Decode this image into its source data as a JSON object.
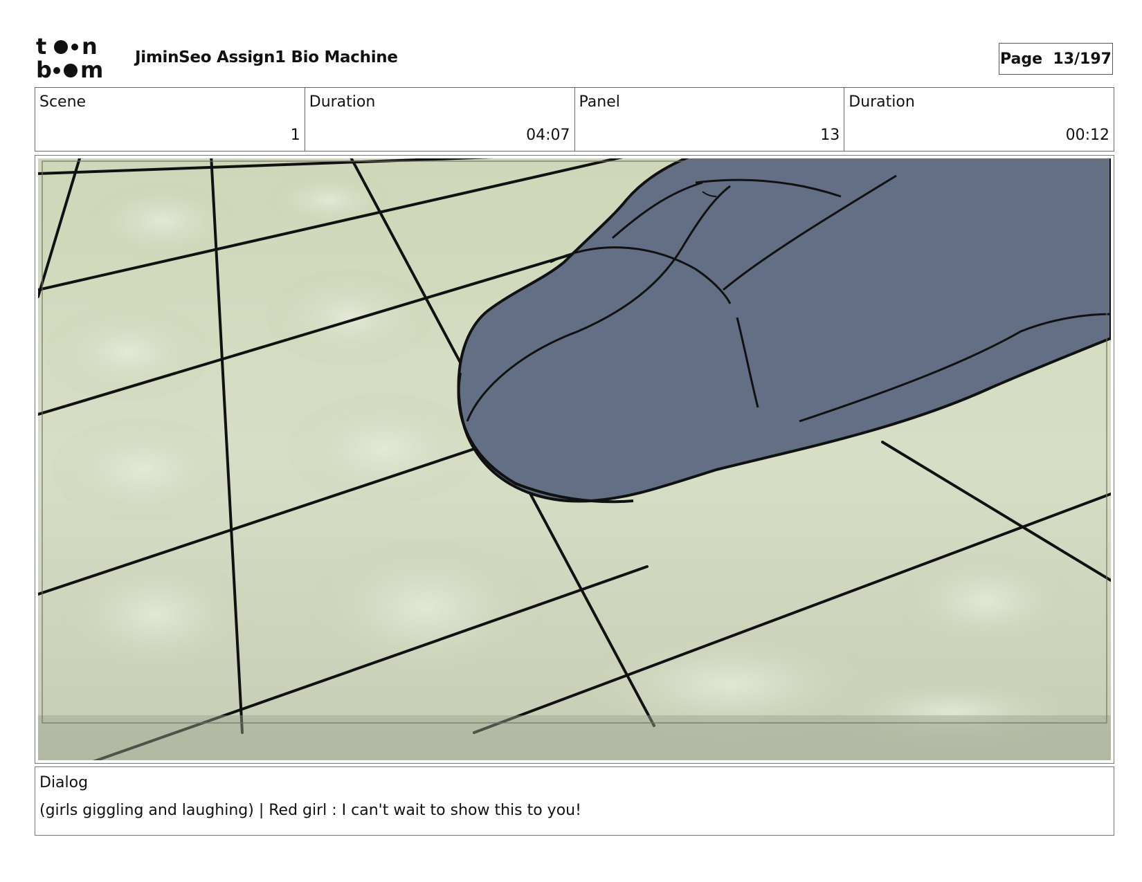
{
  "header": {
    "logo_text": "toon boom",
    "title": "JiminSeo Assign1 Bio Machine",
    "page_label": "Page",
    "page_value": "13/197"
  },
  "info": {
    "scene_label": "Scene",
    "scene_value": "1",
    "scene_duration_label": "Duration",
    "scene_duration_value": "04:07",
    "panel_label": "Panel",
    "panel_value": "13",
    "panel_duration_label": "Duration",
    "panel_duration_value": "00:12"
  },
  "panel": {
    "image": "storyboard-sketch-shoe-on-tiled-floor",
    "colors": {
      "tile": "#c9d2b4",
      "tile_light": "#dfe5d0",
      "shoe": "#636f84",
      "line": "#111111"
    }
  },
  "dialog": {
    "label": "Dialog",
    "text": "(girls giggling and laughing) | Red girl : I can't wait to show this to you!"
  }
}
